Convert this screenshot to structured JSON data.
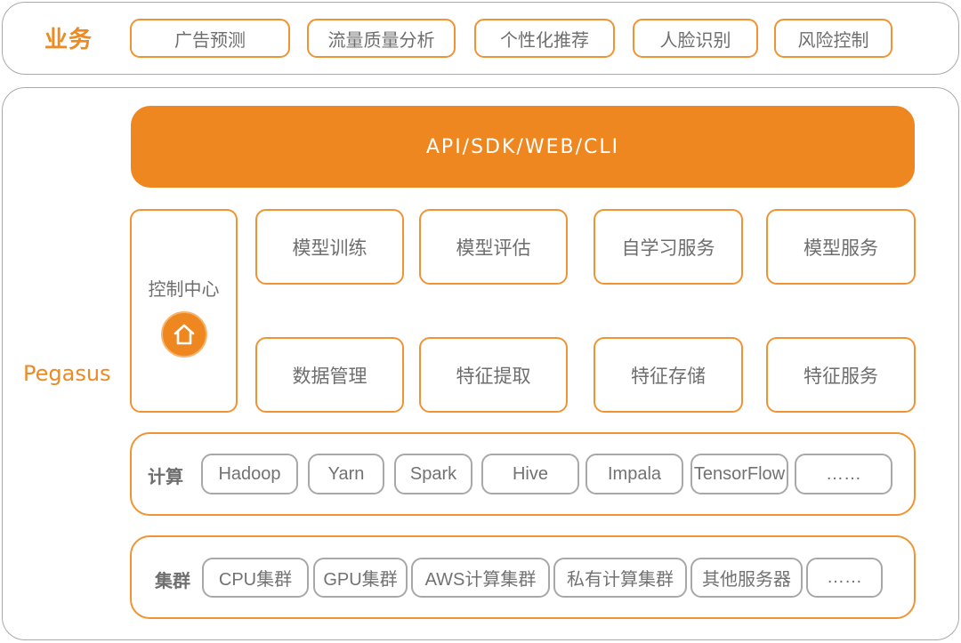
{
  "business": {
    "label": "业务",
    "items": [
      "广告预测",
      "流量质量分析",
      "个性化推荐",
      "人脸识别",
      "风险控制"
    ]
  },
  "platform": {
    "label": "Pegasus",
    "api_bar": "API/SDK/WEB/CLI",
    "control_center": {
      "label": "控制中心",
      "icon": "home-icon"
    },
    "modules_top": [
      "模型训练",
      "模型评估",
      "自学习服务",
      "模型服务"
    ],
    "modules_bottom": [
      "数据管理",
      "特征提取",
      "特征存储",
      "特征服务"
    ],
    "compute": {
      "label": "计算",
      "items": [
        "Hadoop",
        "Yarn",
        "Spark",
        "Hive",
        "Impala",
        "TensorFlow",
        "……"
      ]
    },
    "cluster": {
      "label": "集群",
      "items": [
        "CPU集群",
        "GPU集群",
        "AWS计算集群",
        "私有计算集群",
        "其他服务器",
        "……"
      ]
    }
  },
  "colors": {
    "accent": "#ee871f",
    "border_orange": "#f09433",
    "border_gray": "#a8a8a8",
    "text_gray": "#6e6e6e"
  }
}
